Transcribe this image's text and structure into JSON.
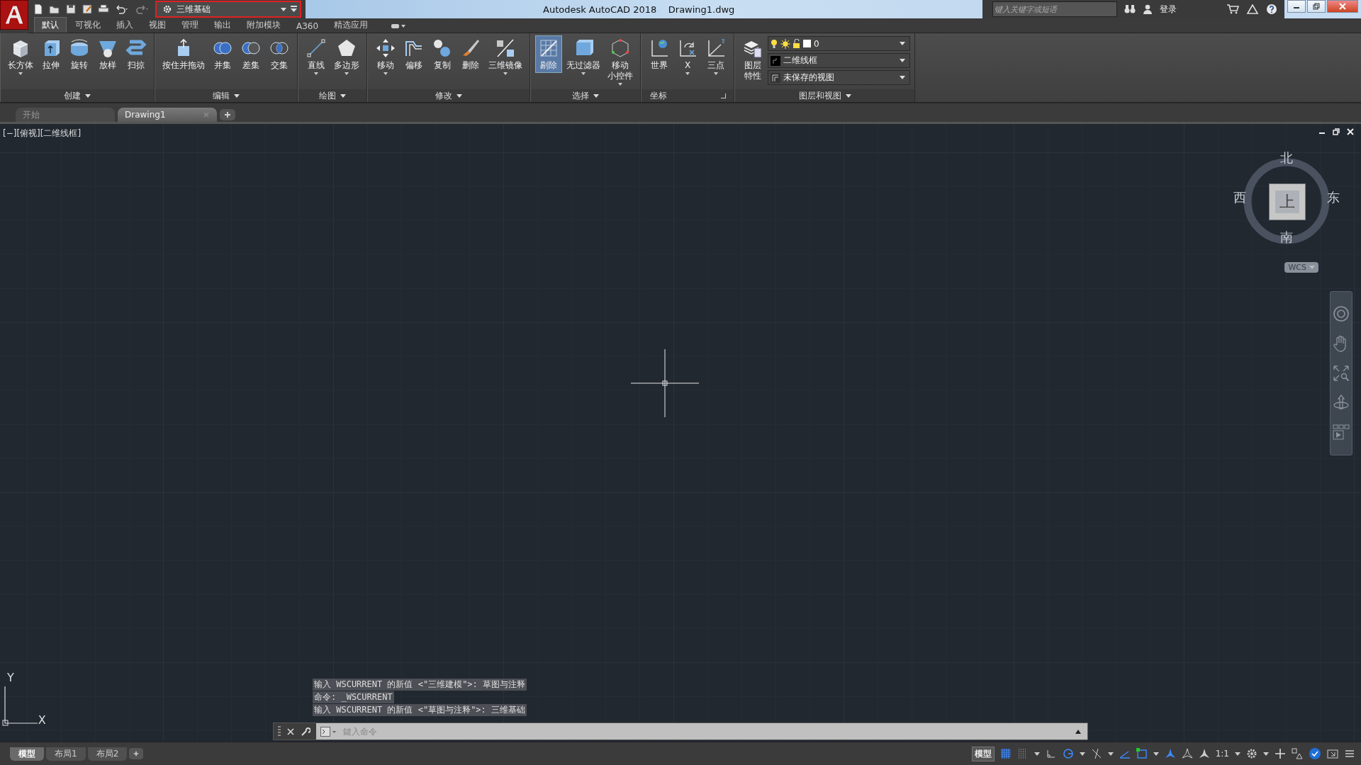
{
  "app": {
    "title": "Autodesk AutoCAD 2018",
    "document": "Drawing1.dwg",
    "workspace": "三维基础",
    "workspace_highlighted": true,
    "search": {
      "placeholder": "键入关键字或短语"
    },
    "sign_in": "登录"
  },
  "ribbon_tabs": [
    {
      "label": "默认",
      "selected": true
    },
    {
      "label": "可视化",
      "selected": false
    },
    {
      "label": "插入",
      "selected": false
    },
    {
      "label": "视图",
      "selected": false
    },
    {
      "label": "管理",
      "selected": false
    },
    {
      "label": "输出",
      "selected": false
    },
    {
      "label": "附加模块",
      "selected": false
    },
    {
      "label": "A360",
      "selected": false
    },
    {
      "label": "精选应用",
      "selected": false
    }
  ],
  "ribbon_panels": [
    {
      "title": "创建",
      "tools": [
        {
          "label": "长方体",
          "caret": true,
          "active": false
        },
        {
          "label": "拉伸",
          "caret": false,
          "active": false
        },
        {
          "label": "旋转",
          "caret": false,
          "active": false
        },
        {
          "label": "放样",
          "caret": false,
          "active": false
        },
        {
          "label": "扫掠",
          "caret": false,
          "active": false
        }
      ]
    },
    {
      "title": "编辑",
      "tools": [
        {
          "label": "按住并拖动",
          "caret": false,
          "active": false
        },
        {
          "label": "并集",
          "caret": false,
          "active": false
        },
        {
          "label": "差集",
          "caret": false,
          "active": false
        },
        {
          "label": "交集",
          "caret": false,
          "active": false
        }
      ]
    },
    {
      "title": "绘图",
      "tools": [
        {
          "label": "直线",
          "caret": true,
          "active": false
        },
        {
          "label": "多边形",
          "caret": true,
          "active": false
        }
      ]
    },
    {
      "title": "修改",
      "tools": [
        {
          "label": "移动",
          "caret": true,
          "active": false
        },
        {
          "label": "偏移",
          "caret": false,
          "active": false
        },
        {
          "label": "复制",
          "caret": false,
          "active": false
        },
        {
          "label": "删除",
          "caret": false,
          "active": false
        },
        {
          "label": "三维镜像",
          "caret": true,
          "active": false
        }
      ]
    },
    {
      "title": "选择",
      "tools": [
        {
          "label": "剔除",
          "caret": false,
          "active": true
        },
        {
          "label": "无过滤器",
          "caret": true,
          "active": false
        },
        {
          "lines": [
            "移动",
            "小控件"
          ],
          "caret": true,
          "active": false
        }
      ]
    },
    {
      "title": "坐标",
      "tools": [
        {
          "label": "世界",
          "caret": false,
          "active": false
        },
        {
          "label": "X",
          "caret": true,
          "active": false
        },
        {
          "label": "三点",
          "caret": true,
          "active": false
        }
      ]
    }
  ],
  "layers_panel": {
    "title": "图层和视图",
    "button_lines": [
      "图层",
      "特性"
    ],
    "layer": "0",
    "visual_style": "二维线框",
    "view": "未保存的视图"
  },
  "document_tabs": [
    {
      "label": "开始",
      "selected": false
    },
    {
      "label": "Drawing1",
      "selected": true
    }
  ],
  "viewport": {
    "controls": "[−][俯视][二维线框]",
    "viewcube": {
      "north": "北",
      "south": "南",
      "east": "东",
      "west": "西",
      "face": "上",
      "ucs": "WCS"
    },
    "ucs_icon": {
      "x": "X",
      "y": "Y"
    }
  },
  "command_line": {
    "history": [
      "输入 WSCURRENT 的新值 <\"三维建模\">: 草图与注释",
      "命令: _WSCURRENT",
      "输入 WSCURRENT 的新值 <\"草图与注释\">: 三维基础"
    ],
    "placeholder": "鍵入命令"
  },
  "layout_tabs": [
    {
      "label": "模型",
      "selected": true
    },
    {
      "label": "布局1",
      "selected": false
    },
    {
      "label": "布局2",
      "selected": false
    }
  ],
  "status_bar": {
    "model_button": "模型",
    "scale": "1:1"
  }
}
